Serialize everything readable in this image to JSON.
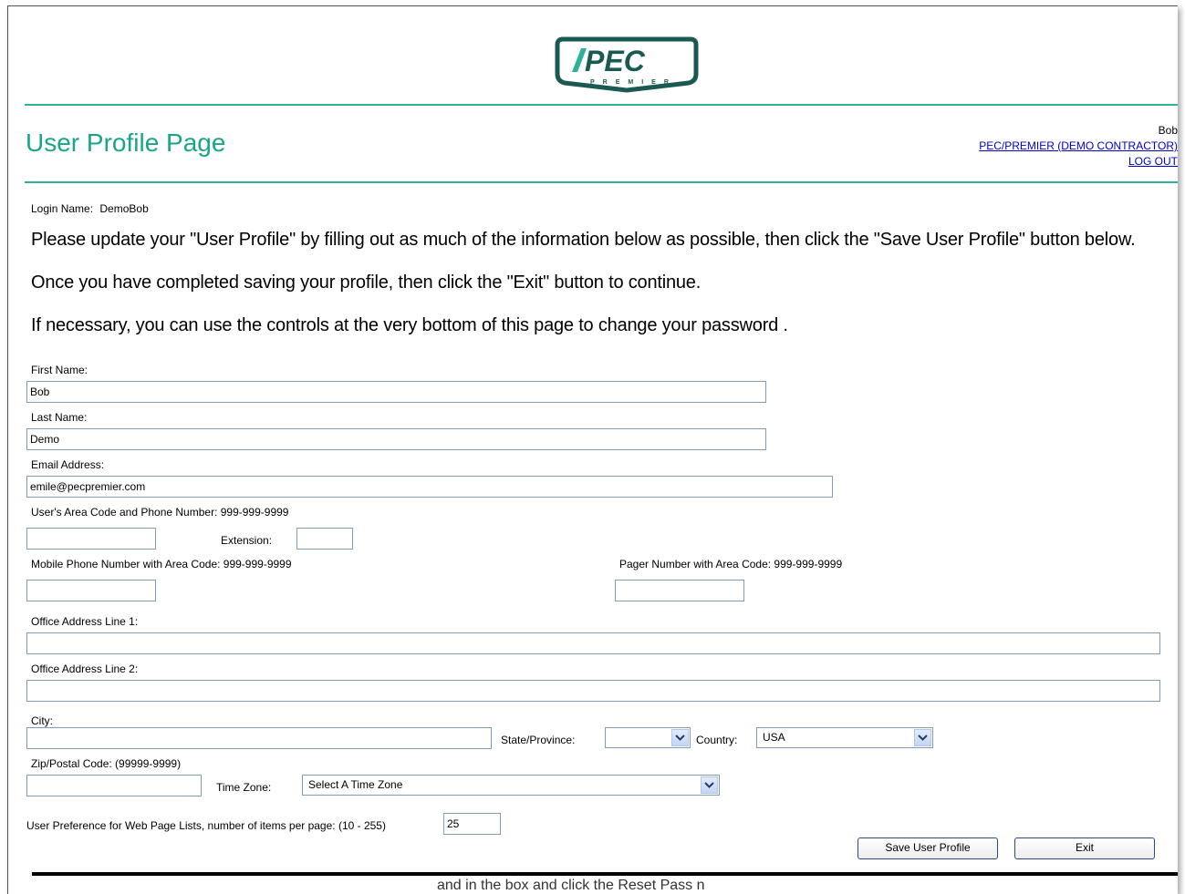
{
  "header": {
    "logo_text": "PEC",
    "logo_subtext": "PREMIER",
    "page_title": "User Profile Page",
    "user_name": "Bob",
    "company_link": "PEC/PREMIER (DEMO CONTRACTOR)",
    "logout_link": "LOG OUT"
  },
  "login": {
    "label": "Login Name:",
    "value": "DemoBob"
  },
  "instructions": [
    "Please update your \"User Profile\" by filling out as much of the information below as possible, then click the \"Save User Profile\" button below.",
    "Once you have completed saving your profile, then click the \"Exit\" button to continue.",
    "If necessary, you can use the controls at the very bottom of this page to change your password ."
  ],
  "form": {
    "first_name": {
      "label": "First Name:",
      "value": "Bob"
    },
    "last_name": {
      "label": "Last Name:",
      "value": "Demo"
    },
    "email": {
      "label": "Email Address:",
      "value": "emile@pecpremier.com"
    },
    "phone": {
      "label": "User's Area Code and Phone Number: 999-999-9999",
      "value": ""
    },
    "extension": {
      "label": "Extension:",
      "value": ""
    },
    "mobile": {
      "label": "Mobile Phone Number with Area Code: 999-999-9999",
      "value": ""
    },
    "pager": {
      "label": "Pager Number with Area Code: 999-999-9999",
      "value": ""
    },
    "address1": {
      "label": "Office Address Line 1:",
      "value": ""
    },
    "address2": {
      "label": "Office Address Line 2:",
      "value": ""
    },
    "city": {
      "label": "City:",
      "value": ""
    },
    "state": {
      "label": "State/Province:",
      "value": ""
    },
    "country": {
      "label": "Country:",
      "value": "USA"
    },
    "zip": {
      "label": "Zip/Postal Code: (99999-9999)",
      "value": ""
    },
    "timezone": {
      "label": "Time Zone:",
      "value": "Select A Time Zone"
    },
    "items_per_page": {
      "label": "User Preference for Web Page Lists, number of items per page: (10 - 255)",
      "value": "25"
    }
  },
  "buttons": {
    "save": "Save User Profile",
    "exit": "Exit"
  },
  "footer_partial_text": "and in the box     and click the  Reset  Pass  n",
  "colors": {
    "accent": "#1aa58a",
    "rule": "#2bb39a",
    "logo": "#1b5a52",
    "link": "#0000cc"
  }
}
